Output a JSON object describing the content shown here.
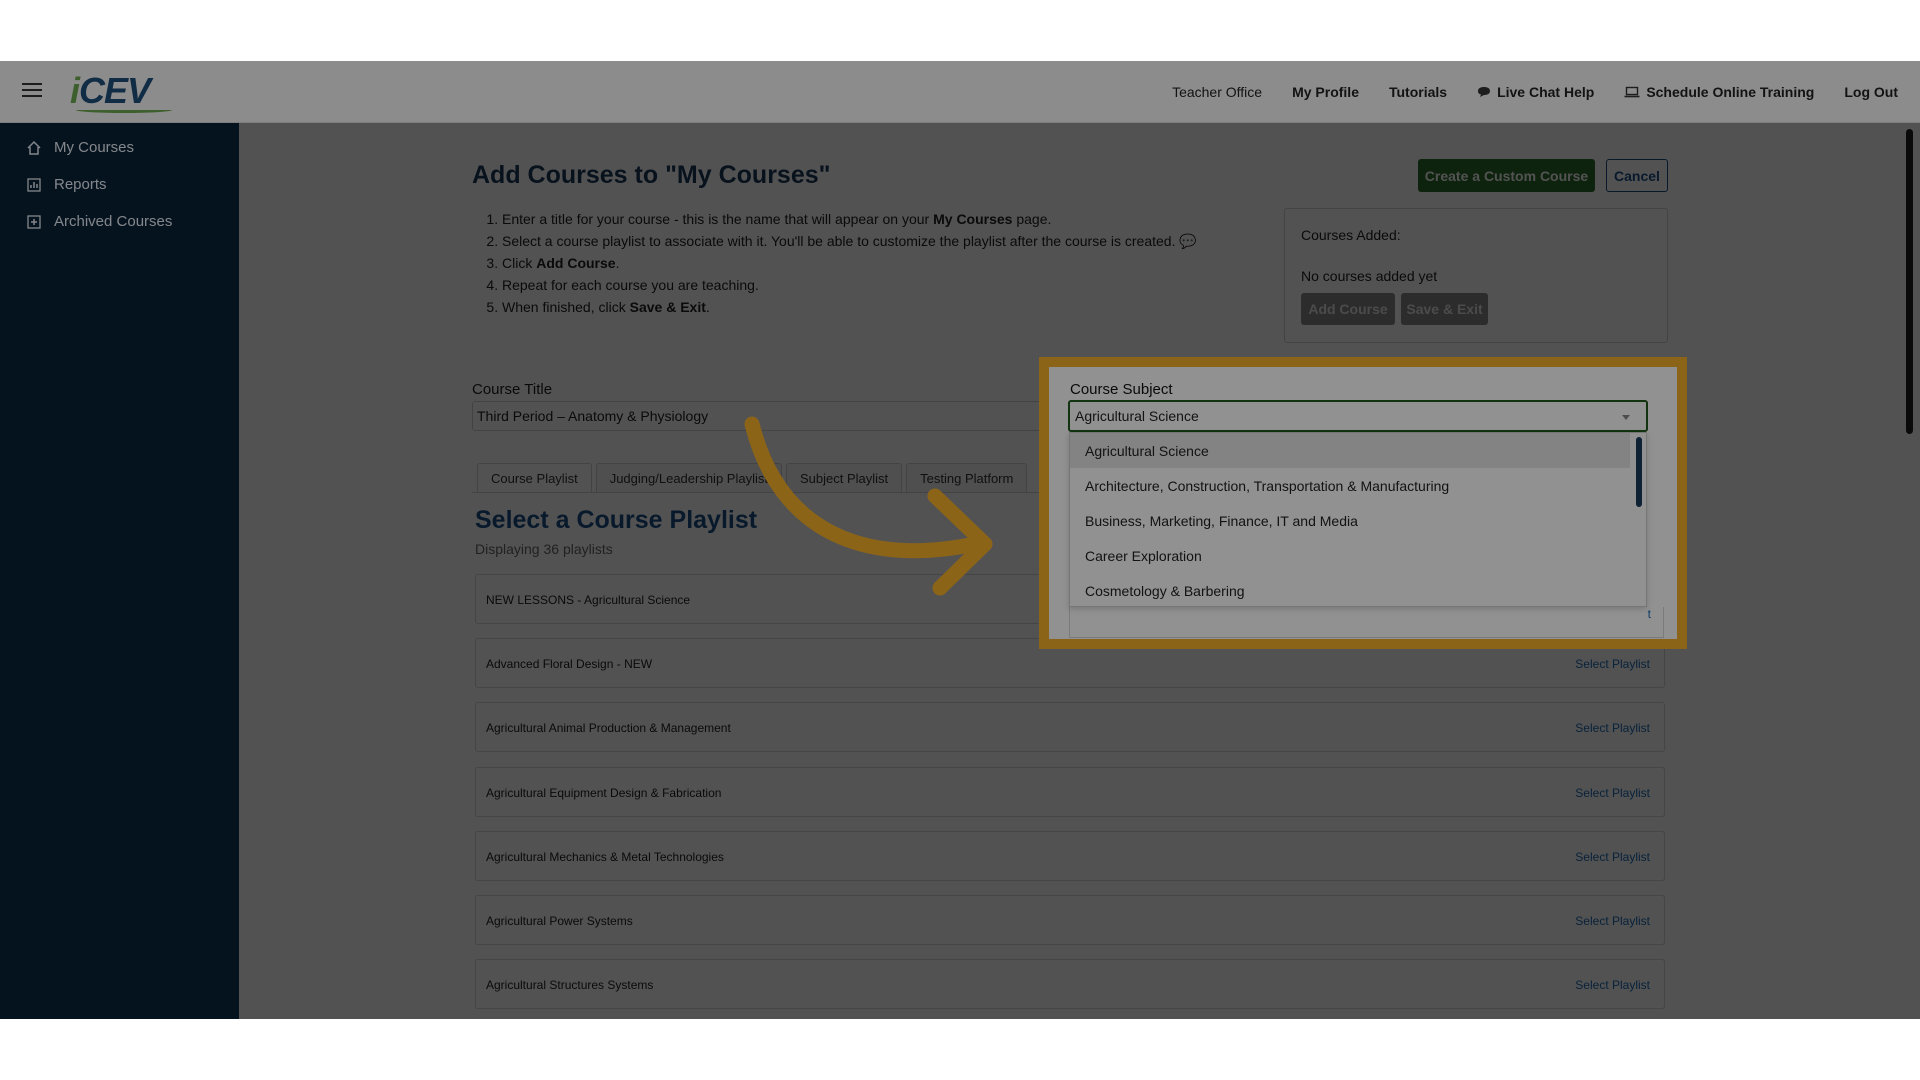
{
  "header": {
    "logo": "iCEV",
    "nav": [
      {
        "label": "Teacher Office",
        "bold": false,
        "icon": ""
      },
      {
        "label": "My Profile",
        "bold": true,
        "icon": ""
      },
      {
        "label": "Tutorials",
        "bold": true,
        "icon": ""
      },
      {
        "label": "Live Chat Help",
        "bold": true,
        "icon": "chat-bubble-icon"
      },
      {
        "label": "Schedule Online Training",
        "bold": true,
        "icon": "laptop-icon"
      },
      {
        "label": "Log Out",
        "bold": true,
        "icon": ""
      }
    ]
  },
  "sidebar": {
    "items": [
      {
        "label": "My Courses",
        "icon": "home-icon"
      },
      {
        "label": "Reports",
        "icon": "chart-icon"
      },
      {
        "label": "Archived Courses",
        "icon": "archive-icon"
      }
    ]
  },
  "page": {
    "title": "Add Courses to \"My Courses\"",
    "steps": {
      "s1a": "Enter a title for your course - this is the name that will appear on your ",
      "s1b": "My Courses",
      "s1c": " page.",
      "s2": "Select a course playlist to associate with it. You'll be able to customize the playlist after the course is created.",
      "s3a": "Click ",
      "s3b": "Add Course",
      "s3c": ".",
      "s4": "Repeat for each course you are teaching.",
      "s5a": "When finished, click ",
      "s5b": "Save & Exit",
      "s5c": "."
    },
    "create_button": "Create a Custom Course",
    "cancel_button": "Cancel"
  },
  "added_panel": {
    "title": "Courses Added:",
    "empty_text": "No courses added yet",
    "add_button": "Add Course",
    "save_button": "Save & Exit"
  },
  "course_title": {
    "label": "Course Title",
    "value": "Third Period – Anatomy & Physiology"
  },
  "tabs": [
    "Course Playlist",
    "Judging/Leadership Playlist",
    "Subject Playlist",
    "Testing Platform"
  ],
  "playlists": {
    "heading": "Select a Course Playlist",
    "count_text": "Displaying 36 playlists",
    "link_label": "Select Playlist",
    "rows": [
      "NEW LESSONS - Agricultural Science",
      "Advanced Floral Design - NEW",
      "Agricultural Animal Production & Management",
      "Agricultural Equipment Design & Fabrication",
      "Agricultural Mechanics & Metal Technologies",
      "Agricultural Power Systems",
      "Agricultural Structures Systems"
    ]
  },
  "course_subject": {
    "label": "Course Subject",
    "selected": "Agricultural Science",
    "options": [
      "Agricultural Science",
      "Architecture, Construction, Transportation & Manufacturing",
      "Business, Marketing, Finance, IT and Media",
      "Career Exploration",
      "Cosmetology & Barbering"
    ]
  },
  "colors": {
    "highlight": "#f6b12b",
    "sidebar_bg": "#0a2238",
    "primary_green": "#2e6e2a",
    "link_blue": "#1b6bb5"
  }
}
